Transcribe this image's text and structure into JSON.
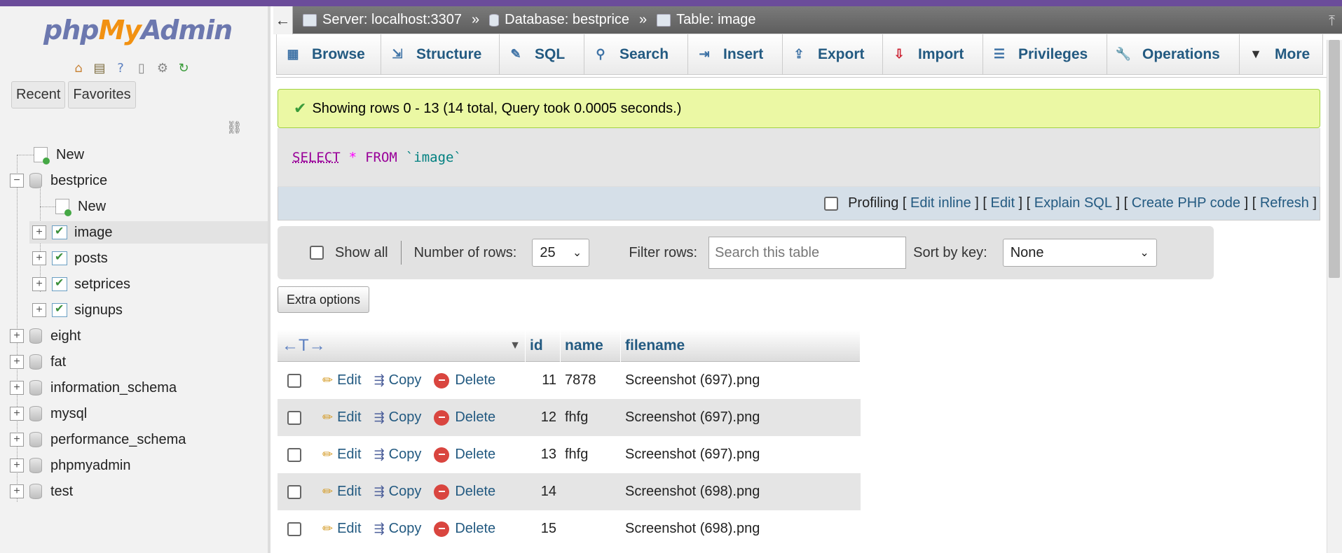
{
  "sidebar": {
    "logo": {
      "php": "php",
      "my": "My",
      "admin": "Admin"
    },
    "tabs": [
      "Recent",
      "Favorites"
    ],
    "tree": {
      "new": "New",
      "bestprice": "bestprice",
      "bestprice_new": "New",
      "tables": [
        "image",
        "posts",
        "setprices",
        "signups"
      ],
      "databases": [
        "eight",
        "fat",
        "information_schema",
        "mysql",
        "performance_schema",
        "phpmyadmin",
        "test"
      ]
    }
  },
  "breadcrumb": {
    "server": "Server: localhost:3307",
    "database": "Database: bestprice",
    "table": "Table: image",
    "sep": "»"
  },
  "tabs": [
    "Browse",
    "Structure",
    "SQL",
    "Search",
    "Insert",
    "Export",
    "Import",
    "Privileges",
    "Operations",
    "More"
  ],
  "message": "Showing rows 0 - 13 (14 total, Query took 0.0005 seconds.)",
  "sql": {
    "select": "SELECT",
    "star": "*",
    "from": "FROM",
    "table": "`image`"
  },
  "sql_actions": {
    "profiling": "Profiling",
    "links": [
      "Edit inline",
      "Edit",
      "Explain SQL",
      "Create PHP code",
      "Refresh"
    ]
  },
  "navbar": {
    "show_all": "Show all",
    "num_rows_label": "Number of rows:",
    "num_rows_value": "25",
    "filter_label": "Filter rows:",
    "filter_placeholder": "Search this table",
    "sort_label": "Sort by key:",
    "sort_value": "None"
  },
  "extra_options": "Extra options",
  "grid": {
    "columns": [
      "id",
      "name",
      "filename"
    ],
    "actions": {
      "edit": "Edit",
      "copy": "Copy",
      "delete": "Delete"
    },
    "rows": [
      {
        "id": "11",
        "name": "7878",
        "filename": "Screenshot (697).png"
      },
      {
        "id": "12",
        "name": "fhfg",
        "filename": "Screenshot (697).png"
      },
      {
        "id": "13",
        "name": "fhfg",
        "filename": "Screenshot (697).png"
      },
      {
        "id": "14",
        "name": "",
        "filename": "Screenshot (698).png"
      },
      {
        "id": "15",
        "name": "",
        "filename": "Screenshot (698).png"
      }
    ]
  },
  "colors": {
    "accent": "#235a81",
    "topbar": "#6b4c9a",
    "success_bg": "#ebf8a4"
  }
}
